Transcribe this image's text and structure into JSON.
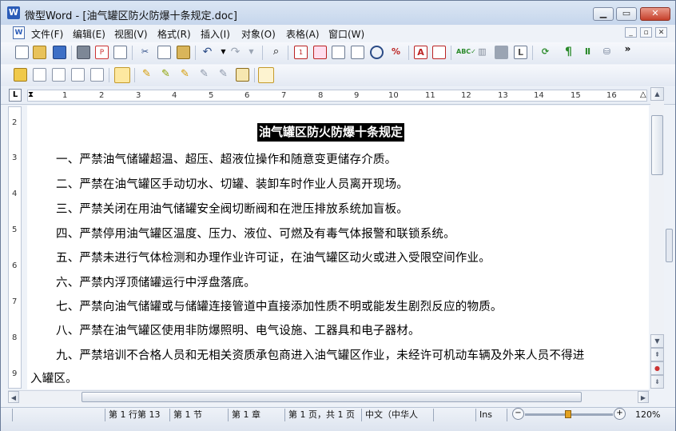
{
  "window": {
    "title": "微型Word - [油气罐区防火防爆十条规定.doc]",
    "app_icon_letter": "W"
  },
  "menu": [
    "文件(F)",
    "编辑(E)",
    "视图(V)",
    "格式(R)",
    "插入(I)",
    "对象(O)",
    "表格(A)",
    "窗口(W)"
  ],
  "ruler": {
    "corner": "L",
    "marks": [
      "1",
      "2",
      "3",
      "4",
      "5",
      "6",
      "7",
      "8",
      "9",
      "10",
      "11",
      "12",
      "13",
      "14",
      "15",
      "16"
    ],
    "vertical": [
      "2",
      "3",
      "4",
      "5",
      "6",
      "7",
      "8",
      "9"
    ]
  },
  "document": {
    "title": "油气罐区防火防爆十条规定",
    "paragraphs": [
      "一、严禁油气储罐超温、超压、超液位操作和随意变更储存介质。",
      "二、严禁在油气罐区手动切水、切罐、装卸车时作业人员离开现场。",
      "三、严禁关闭在用油气储罐安全阀切断阀和在泄压排放系统加盲板。",
      "四、严禁停用油气罐区温度、压力、液位、可燃及有毒气体报警和联锁系统。",
      "五、严禁未进行气体检测和办理作业许可证，在油气罐区动火或进入受限空间作业。",
      "六、严禁内浮顶储罐运行中浮盘落底。",
      "七、严禁向油气储罐或与储罐连接管道中直接添加性质不明或能发生剧烈反应的物质。",
      "八、严禁在油气罐区使用非防爆照明、电气设施、工器具和电子器材。",
      "九、严禁培训不合格人员和无相关资质承包商进入油气罐区作业，未经许可机动车辆及外来人员不得进",
      "入罐区。"
    ]
  },
  "status": {
    "position": "第 1 行第 13",
    "section": "第 1 节",
    "chapter": "第 1 章",
    "pages": "第 1 页，共 1 页",
    "language": "中文（中华人",
    "mode": "Ins",
    "zoom": "120%"
  },
  "colors": {
    "accent_blue": "#2b5cb8",
    "close_red": "#c6402b",
    "zoom_thumb": "#e3a221"
  }
}
